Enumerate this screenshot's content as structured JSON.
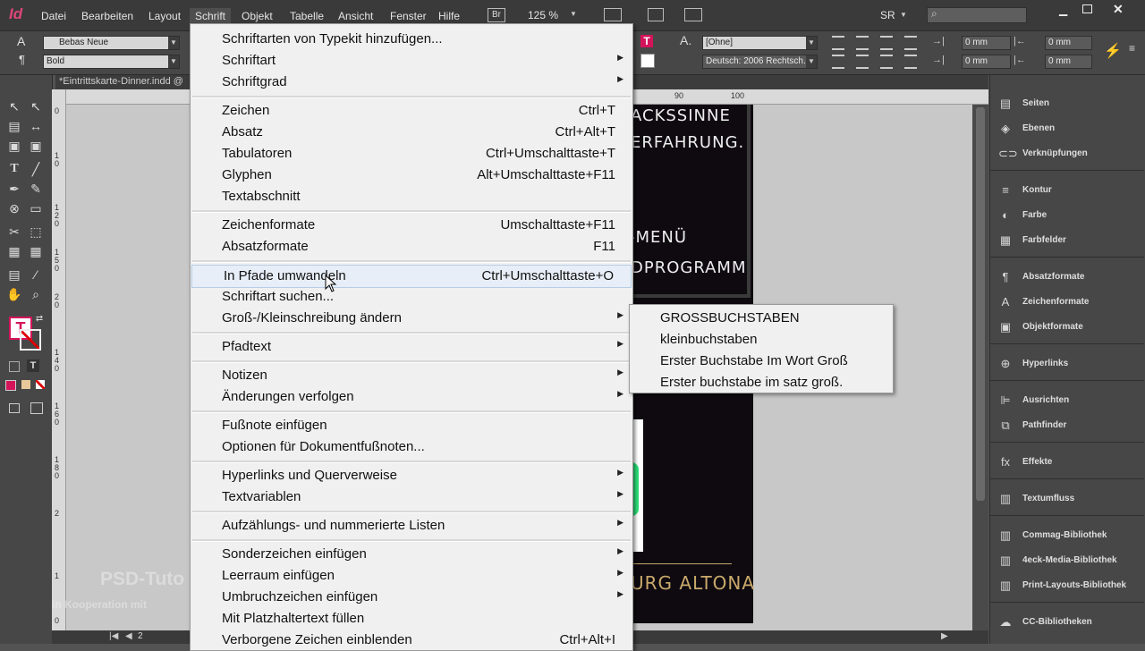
{
  "menubar": {
    "logo": "Id",
    "items": [
      "Datei",
      "Bearbeiten",
      "Layout",
      "Schrift",
      "Objekt",
      "Tabelle",
      "Ansicht",
      "Fenster",
      "Hilfe"
    ],
    "bridge": "Br",
    "zoom": "125 %",
    "workspace": "SR"
  },
  "controlbar": {
    "font_family": "Bebas Neue",
    "font_style": "Bold",
    "char_style": "[Ohne]",
    "language": "Deutsch: 2006 Rechtsch...",
    "indent_1": "0 mm",
    "indent_2": "0 mm",
    "indent_3": "0 mm",
    "indent_4": "0 mm"
  },
  "document": {
    "tab_title": "*Eintrittskarte-Dinner.indd @",
    "page_number": "2",
    "ruler_top": [
      "90",
      "100"
    ],
    "ruler_left": [
      "0",
      "1 0",
      "1 2 0",
      "1 5 0",
      "2 0",
      "1 4 0",
      "1 6 0",
      "1 8 0",
      "2",
      "1",
      "0"
    ],
    "page_lines": [
      "ACKSSINNE",
      "ERFAHRUNG.",
      "-MENÜ",
      "DPROGRAMM",
      "URG ALTONA"
    ]
  },
  "schrift_menu": {
    "items": [
      {
        "label": "Schriftarten von Typekit hinzufügen...",
        "shortcut": "",
        "arrow": false
      },
      {
        "label": "Schriftart",
        "shortcut": "",
        "arrow": true
      },
      {
        "label": "Schriftgrad",
        "shortcut": "",
        "arrow": true
      },
      {
        "label": "Zeichen",
        "shortcut": "Ctrl+T",
        "arrow": false
      },
      {
        "label": "Absatz",
        "shortcut": "Ctrl+Alt+T",
        "arrow": false
      },
      {
        "label": "Tabulatoren",
        "shortcut": "Ctrl+Umschalttaste+T",
        "arrow": false
      },
      {
        "label": "Glyphen",
        "shortcut": "Alt+Umschalttaste+F11",
        "arrow": false
      },
      {
        "label": "Textabschnitt",
        "shortcut": "",
        "arrow": false
      },
      {
        "label": "Zeichenformate",
        "shortcut": "Umschalttaste+F11",
        "arrow": false
      },
      {
        "label": "Absatzformate",
        "shortcut": "F11",
        "arrow": false
      },
      {
        "label": "In Pfade umwandeln",
        "shortcut": "Ctrl+Umschalttaste+O",
        "arrow": false
      },
      {
        "label": "Schriftart suchen...",
        "shortcut": "",
        "arrow": false
      },
      {
        "label": "Groß-/Kleinschreibung ändern",
        "shortcut": "",
        "arrow": true
      },
      {
        "label": "Pfadtext",
        "shortcut": "",
        "arrow": true
      },
      {
        "label": "Notizen",
        "shortcut": "",
        "arrow": true
      },
      {
        "label": "Änderungen verfolgen",
        "shortcut": "",
        "arrow": true
      },
      {
        "label": "Fußnote einfügen",
        "shortcut": "",
        "arrow": false
      },
      {
        "label": "Optionen für Dokumentfußnoten...",
        "shortcut": "",
        "arrow": false
      },
      {
        "label": "Hyperlinks und Querverweise",
        "shortcut": "",
        "arrow": true
      },
      {
        "label": "Textvariablen",
        "shortcut": "",
        "arrow": true
      },
      {
        "label": "Aufzählungs- und nummerierte Listen",
        "shortcut": "",
        "arrow": true
      },
      {
        "label": "Sonderzeichen einfügen",
        "shortcut": "",
        "arrow": true
      },
      {
        "label": "Leerraum einfügen",
        "shortcut": "",
        "arrow": true
      },
      {
        "label": "Umbruchzeichen einfügen",
        "shortcut": "",
        "arrow": true
      },
      {
        "label": "Mit Platzhaltertext füllen",
        "shortcut": "",
        "arrow": false
      },
      {
        "label": "Verborgene Zeichen einblenden",
        "shortcut": "Ctrl+Alt+I",
        "arrow": false
      }
    ],
    "highlighted_index": 10
  },
  "case_submenu": {
    "items": [
      "GROSSBUCHSTABEN",
      "kleinbuchstaben",
      "Erster Buchstabe Im Wort Groß",
      "Erster buchstabe im satz groß."
    ]
  },
  "panels": [
    {
      "label": "Seiten",
      "icon": "pages-icon"
    },
    {
      "label": "Ebenen",
      "icon": "layers-icon"
    },
    {
      "label": "Verknüpfungen",
      "icon": "links-icon"
    },
    {
      "label": "Kontur",
      "icon": "stroke-icon"
    },
    {
      "label": "Farbe",
      "icon": "color-icon"
    },
    {
      "label": "Farbfelder",
      "icon": "swatches-icon"
    },
    {
      "label": "Absatzformate",
      "icon": "paragraph-styles-icon"
    },
    {
      "label": "Zeichenformate",
      "icon": "character-styles-icon"
    },
    {
      "label": "Objektformate",
      "icon": "object-styles-icon"
    },
    {
      "label": "Hyperlinks",
      "icon": "hyperlinks-icon"
    },
    {
      "label": "Ausrichten",
      "icon": "align-icon"
    },
    {
      "label": "Pathfinder",
      "icon": "pathfinder-icon"
    },
    {
      "label": "Effekte",
      "icon": "effects-icon"
    },
    {
      "label": "Textumfluss",
      "icon": "text-wrap-icon"
    },
    {
      "label": "Commag-Bibliothek",
      "icon": "library-icon"
    },
    {
      "label": "4eck-Media-Bibliothek",
      "icon": "library-icon"
    },
    {
      "label": "Print-Layouts-Bibliothek",
      "icon": "library-icon"
    },
    {
      "label": "CC-Bibliotheken",
      "icon": "cc-libraries-icon"
    }
  ],
  "watermark": {
    "line1": "PSD-Tuto",
    "line2": "In Kooperation mit"
  },
  "colors": {
    "accent_menu": "#e7eef7",
    "page_bg": "#0e0a10",
    "type_tool": "#d4145a"
  }
}
